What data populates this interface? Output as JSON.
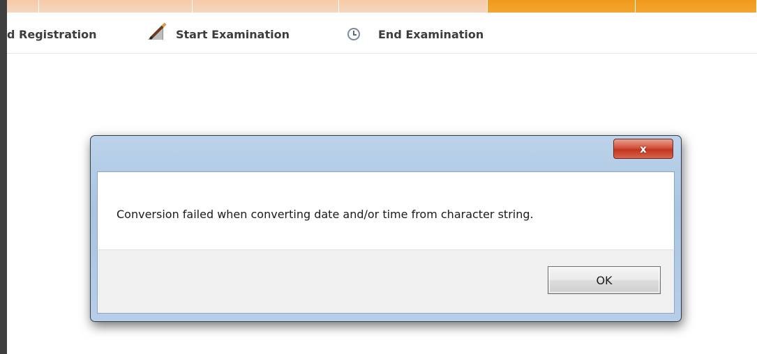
{
  "menu": {
    "registration_label": "d Registration",
    "start_exam_label": "Start Examination",
    "end_exam_label": "End Examination",
    "start_exam_icon": "pencil-paper-icon",
    "end_exam_icon": "clock-icon"
  },
  "dialog": {
    "close_label": "x",
    "message": "Conversion failed when converting date and/or time from character string.",
    "ok_label": "OK"
  },
  "colors": {
    "accent_orange": "#f09a1c",
    "close_red": "#c3351e",
    "dialog_frame": "#a9c5e2"
  }
}
